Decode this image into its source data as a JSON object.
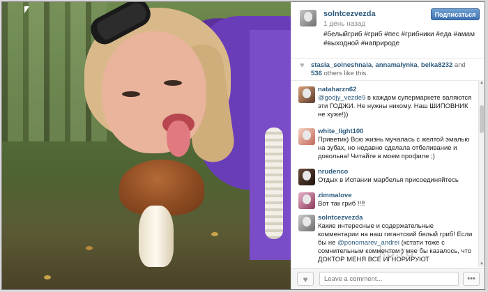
{
  "post": {
    "username": "solntcezvezda",
    "time": "1 день назад",
    "follow_label": "Подписаться",
    "caption": "#белыйгриб #гриб #пес #грибники #еда #амам #выходной #наприроде"
  },
  "likes": {
    "users": [
      "stasia_solneshnaia",
      "annamalynka",
      "belka8232"
    ],
    "separator": ", ",
    "and_label": "and",
    "count": "536",
    "tail": "others like this."
  },
  "comments": [
    {
      "user": "nataharzn62",
      "mention": "@godjy_vezde9",
      "text": "в каждом супермаркете валяются эти ГОДЖИ. Не нужны никому. Наш ШИПОВНИК не хуже!))"
    },
    {
      "user": "white_light100",
      "mention": "",
      "text": "Приветик) Всю жизнь мучалась с желтой эмалью на зубах, но недавно сделала отбеливание и довольна! Читайте в моем профиле ;)"
    },
    {
      "user": "nrudenco",
      "mention": "",
      "text": "Отдых в Испании марбелья присоединяйтесь"
    },
    {
      "user": "zimmalove",
      "mention": "",
      "text": "Вот так гриб !!!!"
    },
    {
      "user": "solntcezvezda",
      "text_before": "Какие интересные и содержательные комментарии на наш гигантский белый гриб! Если бы не",
      "mention": "@ponomarev_andrei",
      "text_after": "(кстати тоже с сомнительным комментом ) мне бы казалось, что ДОКТОР МЕНЯ ВСЕ ИГНОРИРУЮТ"
    }
  ],
  "input": {
    "placeholder": "Leave a comment..."
  },
  "icons": {
    "heart": "heart-icon",
    "more": "more-icon"
  },
  "watermark": "ka.ru"
}
